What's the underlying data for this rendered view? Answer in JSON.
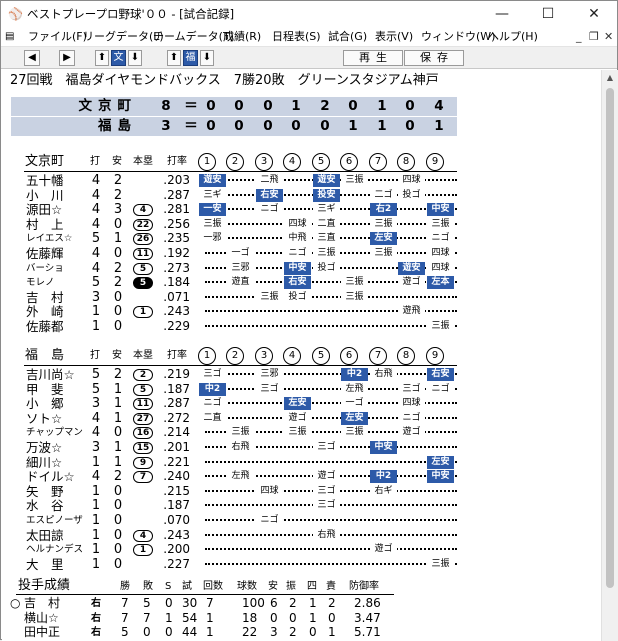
{
  "window": {
    "title": "ベストプレープロ野球'００ - [試合記録]",
    "app_icon": "baseball-cap-icon",
    "minimize_glyph": "—",
    "maximize_glyph": "☐",
    "close_glyph": "✕"
  },
  "menu": {
    "items": [
      "ファイル(F)",
      "リーグデータ(L)",
      "チームデータ(T)",
      "成績(R)",
      "日程表(S)",
      "試合(G)",
      "表示(V)",
      "ウィンドウ(W)",
      "ヘルプ(H)"
    ],
    "mdi_min": "_",
    "mdi_restore": "❐",
    "mdi_close": "✕"
  },
  "toolbar": {
    "prev": "◀",
    "next": "▶",
    "up1": "⬆",
    "team1": "文",
    "down1": "⬇",
    "up2": "⬆",
    "team2": "福",
    "down2": "⬇",
    "play": "再生",
    "save": "保存"
  },
  "game_header": "27回戦　福島ダイヤモンドバックス　7勝20敗　グリーンスタジアム神戸",
  "scoreboard": [
    {
      "team": "文京町",
      "total": "8",
      "eq": "＝",
      "innings": [
        "0",
        "0",
        "0",
        "1",
        "2",
        "0",
        "1",
        "0",
        "4"
      ]
    },
    {
      "team": "福島",
      "total": "3",
      "eq": "＝",
      "innings": [
        "0",
        "0",
        "0",
        "0",
        "0",
        "1",
        "1",
        "0",
        "1"
      ]
    }
  ],
  "batting_headers": {
    "hits_at_bats": "打",
    "hits": "安",
    "home_runs": "本塁",
    "avg": "打率"
  },
  "inning_labels": [
    "1",
    "2",
    "3",
    "4",
    "5",
    "6",
    "7",
    "8",
    "9"
  ],
  "team1": {
    "name": "文京町",
    "batters": [
      {
        "name": "五十幡",
        "ab": "4",
        "h": "2",
        "hr": "",
        "hr_style": "",
        "avg": ".203",
        "res": [
          {
            "i": 0,
            "t": "遊安",
            "k": "hit"
          },
          {
            "i": 2,
            "t": "二飛",
            "k": ""
          },
          {
            "i": 4,
            "t": "遊安",
            "k": "hit"
          },
          {
            "i": 5,
            "t": "三振",
            "k": ""
          },
          {
            "i": 7,
            "t": "四球",
            "k": ""
          }
        ]
      },
      {
        "name": "小　川",
        "ab": "4",
        "h": "2",
        "hr": "",
        "hr_style": "",
        "avg": ".287",
        "res": [
          {
            "i": 0,
            "t": "三ギ",
            "k": ""
          },
          {
            "i": 2,
            "t": "右安",
            "k": "hit"
          },
          {
            "i": 4,
            "t": "投安",
            "k": "hit"
          },
          {
            "i": 6,
            "t": "二ゴ",
            "k": ""
          },
          {
            "i": 7,
            "t": "投ゴ",
            "k": ""
          }
        ]
      },
      {
        "name": "源田☆",
        "ab": "4",
        "h": "3",
        "hr": "4",
        "hr_style": "",
        "avg": ".281",
        "res": [
          {
            "i": 0,
            "t": "一安",
            "k": "hit"
          },
          {
            "i": 2,
            "t": "ニゴ",
            "k": ""
          },
          {
            "i": 4,
            "t": "三ギ",
            "k": ""
          },
          {
            "i": 6,
            "t": "右2",
            "k": "hit"
          },
          {
            "i": 8,
            "t": "中安",
            "k": "hit"
          }
        ]
      },
      {
        "name": "村　上",
        "ab": "4",
        "h": "0",
        "hr": "22",
        "hr_style": "",
        "avg": ".256",
        "res": [
          {
            "i": 0,
            "t": "三振",
            "k": ""
          },
          {
            "i": 3,
            "t": "四球",
            "k": ""
          },
          {
            "i": 4,
            "t": "二直",
            "k": ""
          },
          {
            "i": 6,
            "t": "三振",
            "k": ""
          },
          {
            "i": 8,
            "t": "三振",
            "k": ""
          }
        ]
      },
      {
        "name": "レイエス☆",
        "small": true,
        "ab": "5",
        "h": "1",
        "hr": "26",
        "hr_style": "",
        "avg": ".235",
        "res": [
          {
            "i": 0,
            "t": "一邪",
            "k": ""
          },
          {
            "i": 3,
            "t": "中飛",
            "k": ""
          },
          {
            "i": 4,
            "t": "三直",
            "k": ""
          },
          {
            "i": 6,
            "t": "左安",
            "k": "hit"
          },
          {
            "i": 8,
            "t": "ニゴ",
            "k": ""
          }
        ]
      },
      {
        "name": "佐藤輝",
        "ab": "4",
        "h": "0",
        "hr": "11",
        "hr_style": "",
        "avg": ".192",
        "res": [
          {
            "i": 1,
            "t": "一ゴ",
            "k": ""
          },
          {
            "i": 3,
            "t": "ニゴ",
            "k": ""
          },
          {
            "i": 4,
            "t": "三振",
            "k": ""
          },
          {
            "i": 6,
            "t": "三振",
            "k": ""
          },
          {
            "i": 8,
            "t": "四球",
            "k": ""
          }
        ]
      },
      {
        "name": "バーショ",
        "small": true,
        "ab": "4",
        "h": "2",
        "hr": "5",
        "hr_style": "",
        "avg": ".273",
        "res": [
          {
            "i": 1,
            "t": "三邪",
            "k": ""
          },
          {
            "i": 3,
            "t": "中安",
            "k": "hit"
          },
          {
            "i": 4,
            "t": "投ゴ",
            "k": ""
          },
          {
            "i": 7,
            "t": "遊安",
            "k": "hit"
          },
          {
            "i": 8,
            "t": "四球",
            "k": ""
          }
        ]
      },
      {
        "name": "モレノ",
        "small": true,
        "ab": "5",
        "h": "2",
        "hr": "5",
        "hr_style": "blk",
        "avg": ".184",
        "res": [
          {
            "i": 1,
            "t": "遊直",
            "k": ""
          },
          {
            "i": 3,
            "t": "右安",
            "k": "hit"
          },
          {
            "i": 5,
            "t": "三振",
            "k": ""
          },
          {
            "i": 7,
            "t": "遊ゴ",
            "k": ""
          },
          {
            "i": 8,
            "t": "左本",
            "k": "hit"
          }
        ]
      },
      {
        "name": "吉　村",
        "ab": "3",
        "h": "0",
        "hr": "",
        "hr_style": "",
        "avg": ".071",
        "res": [
          {
            "i": 2,
            "t": "三振",
            "k": ""
          },
          {
            "i": 3,
            "t": "投ゴ",
            "k": ""
          },
          {
            "i": 5,
            "t": "三振",
            "k": ""
          }
        ]
      },
      {
        "name": "外　崎",
        "ab": "1",
        "h": "0",
        "hr": "1",
        "hr_style": "",
        "avg": ".243",
        "res": [
          {
            "i": 7,
            "t": "遊飛",
            "k": ""
          }
        ]
      },
      {
        "name": "佐藤都",
        "ab": "1",
        "h": "0",
        "hr": "",
        "hr_style": "",
        "avg": ".229",
        "res": [
          {
            "i": 8,
            "t": "三振",
            "k": ""
          }
        ]
      }
    ]
  },
  "team2": {
    "name": "福　島",
    "batters": [
      {
        "name": "吉川尚☆",
        "ab": "5",
        "h": "2",
        "hr": "2",
        "hr_style": "",
        "avg": ".219",
        "res": [
          {
            "i": 0,
            "t": "三ゴ",
            "k": ""
          },
          {
            "i": 2,
            "t": "三邪",
            "k": ""
          },
          {
            "i": 5,
            "t": "中2",
            "k": "hit"
          },
          {
            "i": 6,
            "t": "右飛",
            "k": ""
          },
          {
            "i": 8,
            "t": "右安",
            "k": "hit"
          }
        ]
      },
      {
        "name": "甲　斐",
        "ab": "5",
        "h": "1",
        "hr": "5",
        "hr_style": "",
        "avg": ".187",
        "res": [
          {
            "i": 0,
            "t": "中2",
            "k": "hit"
          },
          {
            "i": 2,
            "t": "三ゴ",
            "k": ""
          },
          {
            "i": 5,
            "t": "左飛",
            "k": ""
          },
          {
            "i": 7,
            "t": "三ゴ",
            "k": ""
          },
          {
            "i": 8,
            "t": "ニゴ",
            "k": ""
          }
        ]
      },
      {
        "name": "小　郷",
        "ab": "3",
        "h": "1",
        "hr": "11",
        "hr_style": "",
        "avg": ".287",
        "res": [
          {
            "i": 0,
            "t": "ニゴ",
            "k": ""
          },
          {
            "i": 3,
            "t": "左安",
            "k": "hit"
          },
          {
            "i": 5,
            "t": "一ゴ",
            "k": ""
          },
          {
            "i": 7,
            "t": "四球",
            "k": ""
          }
        ]
      },
      {
        "name": "ソト☆",
        "ab": "4",
        "h": "1",
        "hr": "27",
        "hr_style": "",
        "avg": ".272",
        "res": [
          {
            "i": 0,
            "t": "二直",
            "k": ""
          },
          {
            "i": 3,
            "t": "遊ゴ",
            "k": ""
          },
          {
            "i": 5,
            "t": "左安",
            "k": "hit"
          },
          {
            "i": 7,
            "t": "ニゴ",
            "k": ""
          }
        ]
      },
      {
        "name": "チャップマン",
        "small": true,
        "ab": "4",
        "h": "0",
        "hr": "16",
        "hr_style": "",
        "avg": ".214",
        "res": [
          {
            "i": 1,
            "t": "三振",
            "k": ""
          },
          {
            "i": 3,
            "t": "三振",
            "k": ""
          },
          {
            "i": 5,
            "t": "三振",
            "k": ""
          },
          {
            "i": 7,
            "t": "遊ゴ",
            "k": ""
          }
        ]
      },
      {
        "name": "万波☆",
        "ab": "3",
        "h": "1",
        "hr": "15",
        "hr_style": "",
        "avg": ".201",
        "res": [
          {
            "i": 1,
            "t": "右飛",
            "k": ""
          },
          {
            "i": 4,
            "t": "三ゴ",
            "k": ""
          },
          {
            "i": 6,
            "t": "中安",
            "k": "hit"
          }
        ]
      },
      {
        "name": "細川☆",
        "ab": "1",
        "h": "1",
        "hr": "9",
        "hr_style": "",
        "avg": ".221",
        "res": [
          {
            "i": 8,
            "t": "左安",
            "k": "hit"
          }
        ]
      },
      {
        "name": "ドイル☆",
        "ab": "4",
        "h": "2",
        "hr": "7",
        "hr_style": "",
        "avg": ".240",
        "res": [
          {
            "i": 1,
            "t": "左飛",
            "k": ""
          },
          {
            "i": 4,
            "t": "遊ゴ",
            "k": ""
          },
          {
            "i": 6,
            "t": "中2",
            "k": "hit"
          },
          {
            "i": 8,
            "t": "中安",
            "k": "hit"
          }
        ]
      },
      {
        "name": "矢　野",
        "ab": "1",
        "h": "0",
        "hr": "",
        "hr_style": "",
        "avg": ".215",
        "res": [
          {
            "i": 2,
            "t": "四球",
            "k": ""
          },
          {
            "i": 4,
            "t": "三ゴ",
            "k": ""
          },
          {
            "i": 6,
            "t": "右ギ",
            "k": ""
          }
        ]
      },
      {
        "name": "水　谷",
        "ab": "1",
        "h": "0",
        "hr": "",
        "hr_style": "",
        "avg": ".187",
        "res": [
          {
            "i": 4,
            "t": "三ゴ",
            "k": ""
          }
        ]
      },
      {
        "name": "エスピノーザ",
        "small": true,
        "ab": "1",
        "h": "0",
        "hr": "",
        "hr_style": "",
        "avg": ".070",
        "res": [
          {
            "i": 2,
            "t": "ニゴ",
            "k": ""
          }
        ]
      },
      {
        "name": "太田諒",
        "ab": "1",
        "h": "0",
        "hr": "4",
        "hr_style": "",
        "avg": ".243",
        "res": [
          {
            "i": 4,
            "t": "右飛",
            "k": ""
          }
        ]
      },
      {
        "name": "ヘルナンデス",
        "small": true,
        "ab": "1",
        "h": "0",
        "hr": "1",
        "hr_style": "",
        "avg": ".200",
        "res": [
          {
            "i": 6,
            "t": "遊ゴ",
            "k": ""
          }
        ]
      },
      {
        "name": "大　里",
        "ab": "1",
        "h": "0",
        "hr": "",
        "hr_style": "",
        "avg": ".227",
        "res": [
          {
            "i": 8,
            "t": "三振",
            "k": ""
          }
        ]
      }
    ]
  },
  "pitching": {
    "title": "投手成績",
    "headers": [
      "勝",
      "敗",
      "S",
      "試",
      "回数",
      "球数",
      "安",
      "振",
      "四",
      "責",
      "防御率"
    ],
    "rows": [
      {
        "mark": "○",
        "name": "吉　村",
        "hand": "右",
        "w": "7",
        "l": "5",
        "s": "0",
        "g": "30",
        "ip": "7",
        "np": "100",
        "h": "6",
        "so": "2",
        "bb": "1",
        "er": "2",
        "era": "2.86"
      },
      {
        "mark": "",
        "name": "横山☆",
        "hand": "右",
        "w": "7",
        "l": "7",
        "s": "1",
        "g": "54",
        "ip": "1",
        "np": "18",
        "h": "0",
        "so": "0",
        "bb": "1",
        "er": "0",
        "era": "3.47"
      },
      {
        "mark": "",
        "name": "田中正",
        "hand": "右",
        "w": "5",
        "l": "0",
        "s": "0",
        "g": "44",
        "ip": "1",
        "np": "22",
        "h": "3",
        "so": "2",
        "bb": "0",
        "er": "1",
        "era": "5.71"
      }
    ]
  }
}
